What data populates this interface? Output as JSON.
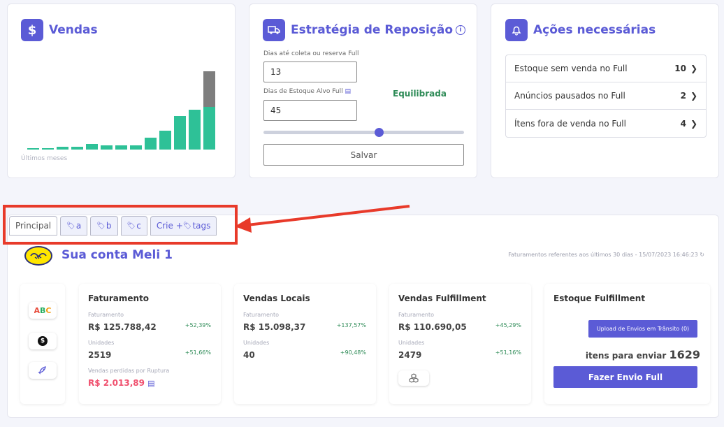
{
  "vendas": {
    "title": "Vendas",
    "icon": "dollar-icon",
    "caption": "Últimos meses",
    "chart_data": {
      "type": "bar",
      "series": [
        {
          "values": [
            1,
            1,
            2,
            2,
            4,
            3,
            3,
            3,
            8,
            13,
            23,
            27,
            29
          ]
        }
      ],
      "projection": [
        0,
        0,
        0,
        0,
        0,
        0,
        0,
        0,
        0,
        0,
        0,
        0,
        24
      ],
      "ylim": [
        0,
        55
      ]
    }
  },
  "estrategia": {
    "title": "Estratégia de Reposição",
    "info_icon": "i",
    "field1_label": "Dias até coleta ou reserva Full",
    "field1_value": "13",
    "field2_label": "Dias de Estoque Alvo Full",
    "field2_value": "45",
    "status": "Equilibrada",
    "slider_value": 0.58,
    "save_label": "Salvar"
  },
  "acoes": {
    "title": "Ações necessárias",
    "items": [
      {
        "label": "Estoque sem venda no Full",
        "count": "10"
      },
      {
        "label": "Anúncios pausados no Full",
        "count": "2"
      },
      {
        "label": "Ítens fora de venda no Full",
        "count": "4"
      }
    ]
  },
  "tabs": [
    {
      "label": "Principal"
    },
    {
      "label": "a"
    },
    {
      "label": "b"
    },
    {
      "label": "c"
    },
    {
      "label": "Crie + ",
      "suffix": "tags"
    }
  ],
  "meli": {
    "title": "Sua conta Meli 1",
    "subtitle": "Faturamentos referentes aos últimos 30 dias - 15/07/2023 16:46:23"
  },
  "side_chips": [
    "ABC",
    "$"
  ],
  "faturamento": {
    "title": "Faturamento",
    "fat_label": "Faturamento",
    "fat_value": "R$ 125.788,42",
    "fat_pct": "+52,39%",
    "un_label": "Unidades",
    "un_value": "2519",
    "un_pct": "+51,66%",
    "perdidas_label": "Vendas perdidas por Ruptura",
    "perdidas_value": "R$ 2.013,89"
  },
  "locais": {
    "title": "Vendas Locais",
    "fat_label": "Faturamento",
    "fat_value": "R$ 15.098,37",
    "fat_pct": "+137,57%",
    "un_label": "Unidades",
    "un_value": "40",
    "un_pct": "+90,48%"
  },
  "fulfillment": {
    "title": "Vendas Fulfillment",
    "fat_label": "Faturamento",
    "fat_value": "R$ 110.690,05",
    "fat_pct": "+45,29%",
    "un_label": "Unidades",
    "un_value": "2479",
    "un_pct": "+51,16%"
  },
  "estoque": {
    "title": "Estoque Fulfillment",
    "upload_label": "Upload de Envios em Trânsito",
    "upload_count": "(0)",
    "itens_label": "itens para enviar",
    "itens_value": "1629",
    "envio_label": "Fazer Envio Full"
  }
}
